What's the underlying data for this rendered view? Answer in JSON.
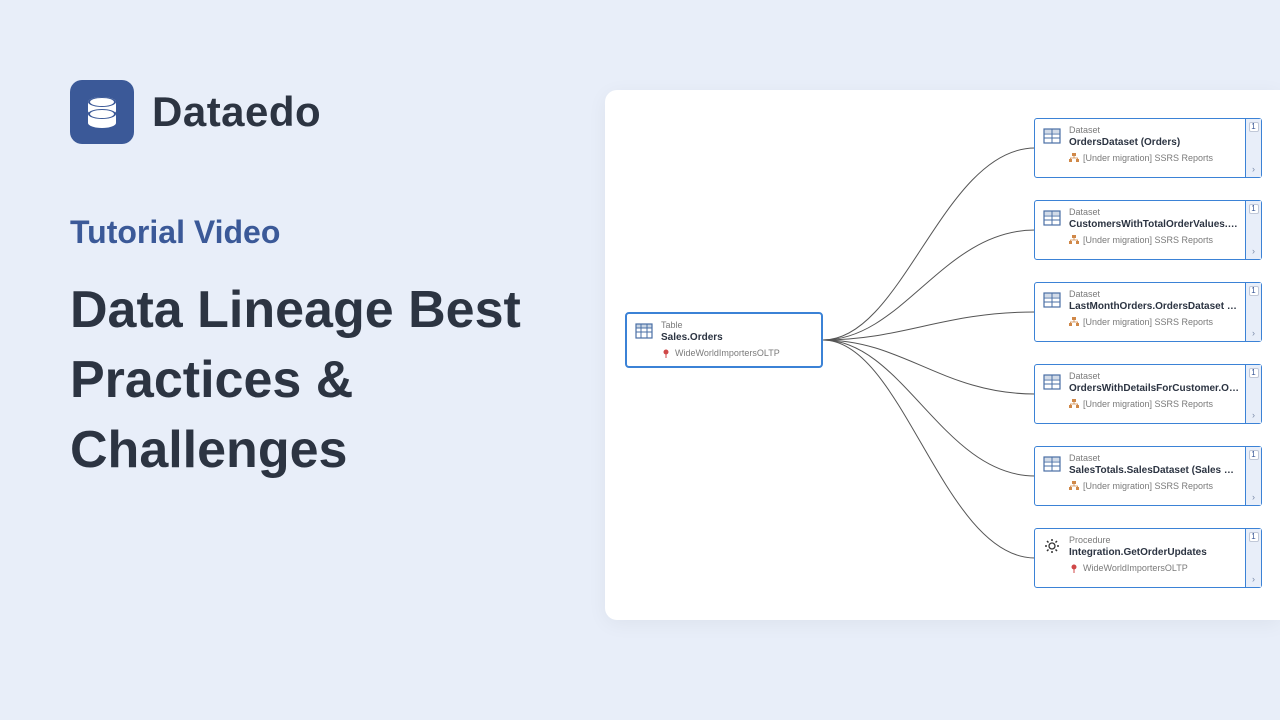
{
  "brand": "Dataedo",
  "subtitle": "Tutorial Video",
  "title": "Data Lineage Best Practices & Challenges",
  "colors": {
    "background": "#e8eef9",
    "accent": "#3b5998",
    "nodeBorder": "#3b82d6",
    "textDark": "#2c3442",
    "textMuted": "#7a7a7a"
  },
  "source": {
    "type": "Table",
    "title": "Sales.Orders",
    "source": "WideWorldImportersOLTP",
    "iconName": "table-icon"
  },
  "targets": [
    {
      "type": "Dataset",
      "title": "OrdersDataset (Orders)",
      "source": "[Under migration] SSRS Reports",
      "badge": "1",
      "iconName": "dataset-icon"
    },
    {
      "type": "Dataset",
      "title": "CustomersWithTotalOrderValues.CustomersD...",
      "source": "[Under migration] SSRS Reports",
      "badge": "1",
      "iconName": "dataset-icon"
    },
    {
      "type": "Dataset",
      "title": "LastMonthOrders.OrdersDataset (Last Month ...",
      "source": "[Under migration] SSRS Reports",
      "badge": "1",
      "iconName": "dataset-icon"
    },
    {
      "type": "Dataset",
      "title": "OrdersWithDetailsForCustomer.OrdersDatase...",
      "source": "[Under migration] SSRS Reports",
      "badge": "1",
      "iconName": "dataset-icon"
    },
    {
      "type": "Dataset",
      "title": "SalesTotals.SalesDataset (Sales Totals)",
      "source": "[Under migration] SSRS Reports",
      "badge": "1",
      "iconName": "dataset-icon"
    },
    {
      "type": "Procedure",
      "title": "Integration.GetOrderUpdates",
      "source": "WideWorldImportersOLTP",
      "badge": "1",
      "iconName": "procedure-icon"
    }
  ]
}
